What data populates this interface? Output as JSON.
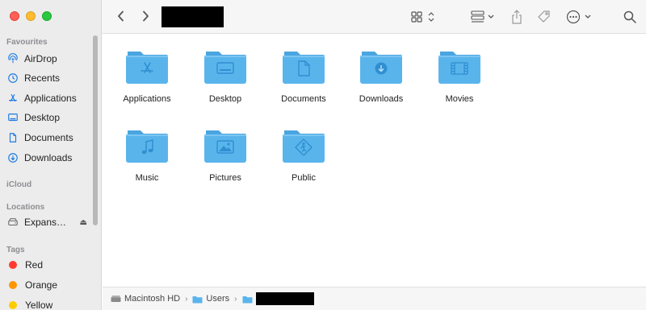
{
  "window": {
    "title": ""
  },
  "toolbar": {
    "back": "chevron-left",
    "forward": "chevron-right",
    "icons": [
      "grid-view-icon",
      "group-by-icon",
      "share-icon",
      "tag-icon",
      "more-icon",
      "search-icon"
    ]
  },
  "sidebar": {
    "favourites_title": "Favourites",
    "favourites": [
      {
        "label": "AirDrop",
        "icon": "airdrop-icon"
      },
      {
        "label": "Recents",
        "icon": "clock-icon"
      },
      {
        "label": "Applications",
        "icon": "applications-icon"
      },
      {
        "label": "Desktop",
        "icon": "desktop-icon"
      },
      {
        "label": "Documents",
        "icon": "document-icon"
      },
      {
        "label": "Downloads",
        "icon": "download-icon"
      }
    ],
    "icloud_title": "iCloud",
    "locations_title": "Locations",
    "locations": [
      {
        "label": "Expans…",
        "icon": "drive-icon",
        "eject": "⏏"
      }
    ],
    "tags_title": "Tags",
    "tags": [
      {
        "label": "Red",
        "color": "#ff3b30"
      },
      {
        "label": "Orange",
        "color": "#ff9500"
      },
      {
        "label": "Yellow",
        "color": "#ffcc00"
      }
    ]
  },
  "items": [
    {
      "label": "Applications",
      "glyph": "applications"
    },
    {
      "label": "Desktop",
      "glyph": "desktop"
    },
    {
      "label": "Documents",
      "glyph": "document"
    },
    {
      "label": "Downloads",
      "glyph": "download"
    },
    {
      "label": "Movies",
      "glyph": "movies"
    },
    {
      "label": "Music",
      "glyph": "music"
    },
    {
      "label": "Pictures",
      "glyph": "pictures"
    },
    {
      "label": "Public",
      "glyph": "public"
    }
  ],
  "pathbar": {
    "segments": [
      "Macintosh HD",
      "Users"
    ],
    "separator": "›"
  },
  "colors": {
    "folder": "#5ab4ec",
    "folder_tab": "#4aa5e0",
    "glyph": "#2f8fd0"
  }
}
